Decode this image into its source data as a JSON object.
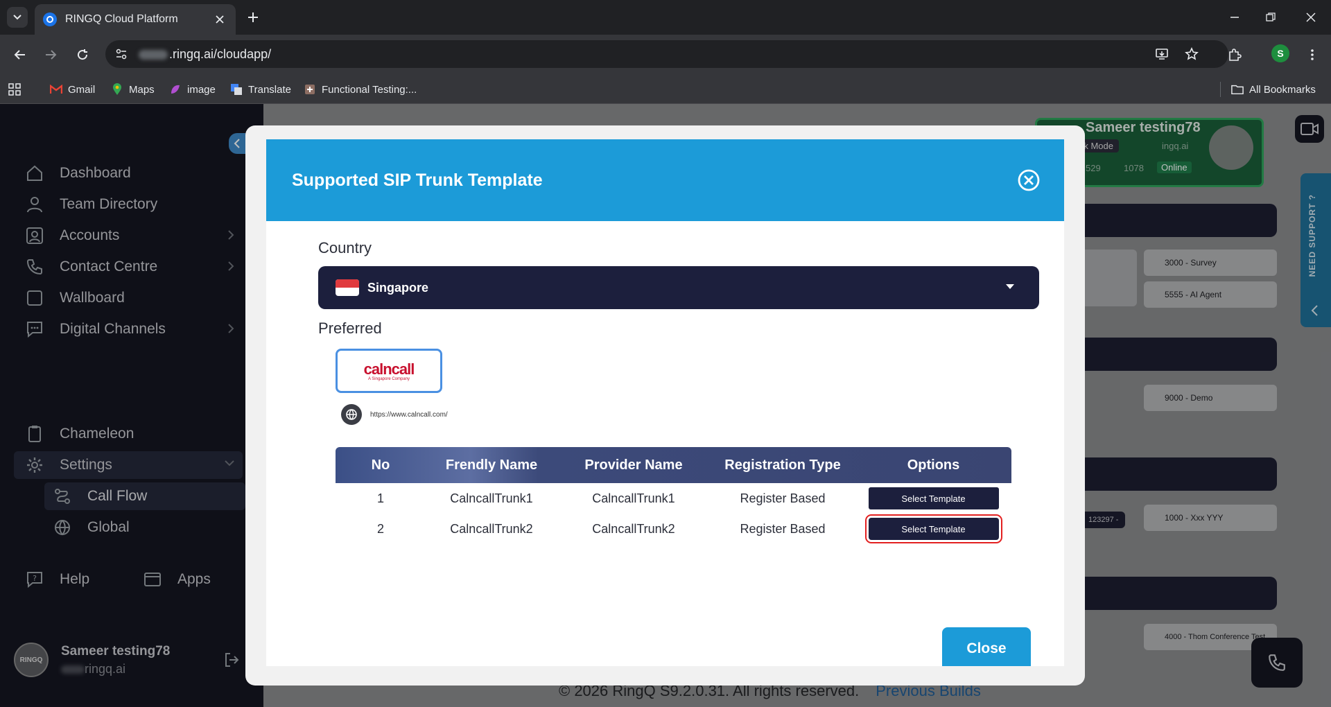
{
  "browser": {
    "tab_title": "RINGQ Cloud Platform",
    "url": ".ringq.ai/cloudapp/",
    "profile_initial": "S",
    "bookmarks": [
      {
        "label": "Gmail",
        "icon": "gmail-icon"
      },
      {
        "label": "Maps",
        "icon": "maps-icon"
      },
      {
        "label": "image",
        "icon": "image-icon"
      },
      {
        "label": "Translate",
        "icon": "translate-icon"
      },
      {
        "label": "Functional Testing:...",
        "icon": "bookmark-favicon"
      }
    ],
    "all_bookmarks": "All Bookmarks"
  },
  "sidebar": {
    "items": [
      {
        "label": "Dashboard",
        "icon": "home-icon"
      },
      {
        "label": "Team Directory",
        "icon": "person-icon"
      },
      {
        "label": "Accounts",
        "icon": "account-icon"
      },
      {
        "label": "Contact Centre",
        "icon": "phone-icon"
      },
      {
        "label": "Wallboard",
        "icon": "square-icon"
      },
      {
        "label": "Digital Channels",
        "icon": "chat-icon"
      },
      {
        "label": "Chameleon",
        "icon": "clipboard-icon"
      },
      {
        "label": "Settings",
        "icon": "gear-icon"
      },
      {
        "label": "Call Flow",
        "icon": "flow-icon"
      },
      {
        "label": "Global",
        "icon": "globe-icon"
      }
    ],
    "help": "Help",
    "apps": "Apps",
    "user": {
      "name": "Sameer testing78",
      "email": "ringq.ai"
    }
  },
  "background": {
    "profile_name": "Sameer testing78",
    "profile_mode": "rk Mode",
    "profile_domain": "ingq.ai",
    "profile_num1": "529",
    "profile_num2": "1078",
    "profile_status": "Online",
    "support": "NEED SUPPORT ?",
    "rows": [
      "3000 - Survey",
      "5555 - AI Agent",
      "9000 - Demo",
      "1000 - Xxx YYY",
      "4000 - Thom Conference Test"
    ],
    "chip": "123297 -",
    "footer": "© 2026 RingQ S9.2.0.31. All rights reserved.",
    "footer_link": "Previous Builds"
  },
  "modal": {
    "title": "Supported SIP Trunk Template",
    "country_label": "Country",
    "country_value": "Singapore",
    "preferred_label": "Preferred",
    "provider_logo": "calncall",
    "provider_tagline": "A Singapore Company",
    "provider_url": "https://www.calncall.com/",
    "table": {
      "headers": [
        "No",
        "Frendly Name",
        "Provider Name",
        "Registration Type",
        "Options"
      ],
      "rows": [
        {
          "no": "1",
          "friendly": "CalncallTrunk1",
          "provider": "CalncallTrunk1",
          "type": "Register Based",
          "option": "Select Template"
        },
        {
          "no": "2",
          "friendly": "CalncallTrunk2",
          "provider": "CalncallTrunk2",
          "type": "Register Based",
          "option": "Select Template"
        }
      ]
    },
    "close_label": "Close"
  }
}
